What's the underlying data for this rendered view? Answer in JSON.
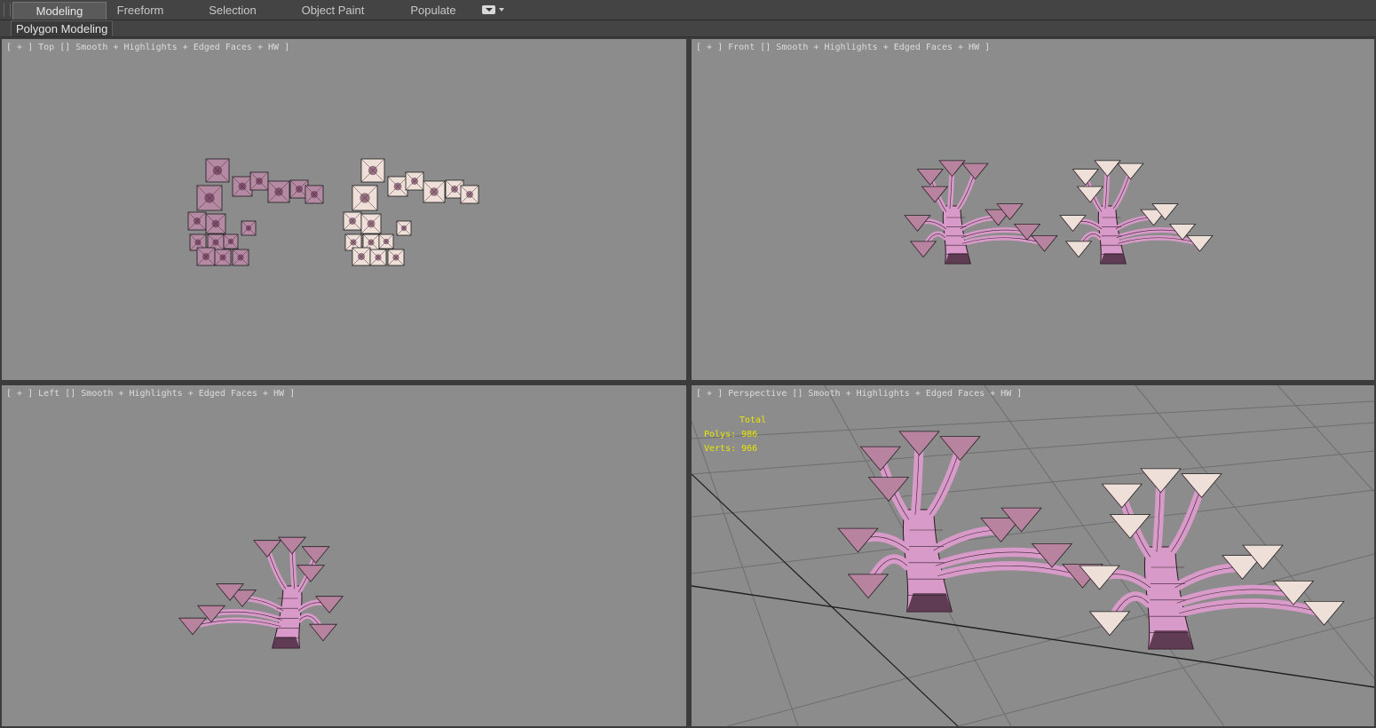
{
  "ribbon": {
    "tabs": [
      {
        "label": "Modeling",
        "active": true
      },
      {
        "label": "Freeform",
        "active": false
      },
      {
        "label": "Selection",
        "active": false
      },
      {
        "label": "Object Paint",
        "active": false
      },
      {
        "label": "Populate",
        "active": false
      }
    ],
    "dropdown_icon": "ribbon-options-dropdown-icon",
    "panel_label": "Polygon Modeling"
  },
  "viewports": {
    "top": {
      "label": "[ + ] Top [] Smooth + Highlights + Edged Faces + HW ]"
    },
    "front": {
      "label": "[ + ] Front [] Smooth + Highlights + Edged Faces + HW ]"
    },
    "left": {
      "label": "[ + ] Left [] Smooth + Highlights + Edged Faces + HW ]"
    },
    "perspective": {
      "label": "[ + ] Perspective [] Smooth + Highlights + Edged Faces + HW ]"
    }
  },
  "statistics": {
    "header": "Total",
    "polys": "Polys: 986",
    "verts": "Verts: 966"
  },
  "colors": {
    "viewport_bg": "#8c8c8c",
    "ui_bg": "#444444",
    "stats_text": "#e8e800",
    "tree_pink": "#d89ac8",
    "tree_dark": "#4a2a40",
    "leaf_light": "#eee0d8"
  }
}
